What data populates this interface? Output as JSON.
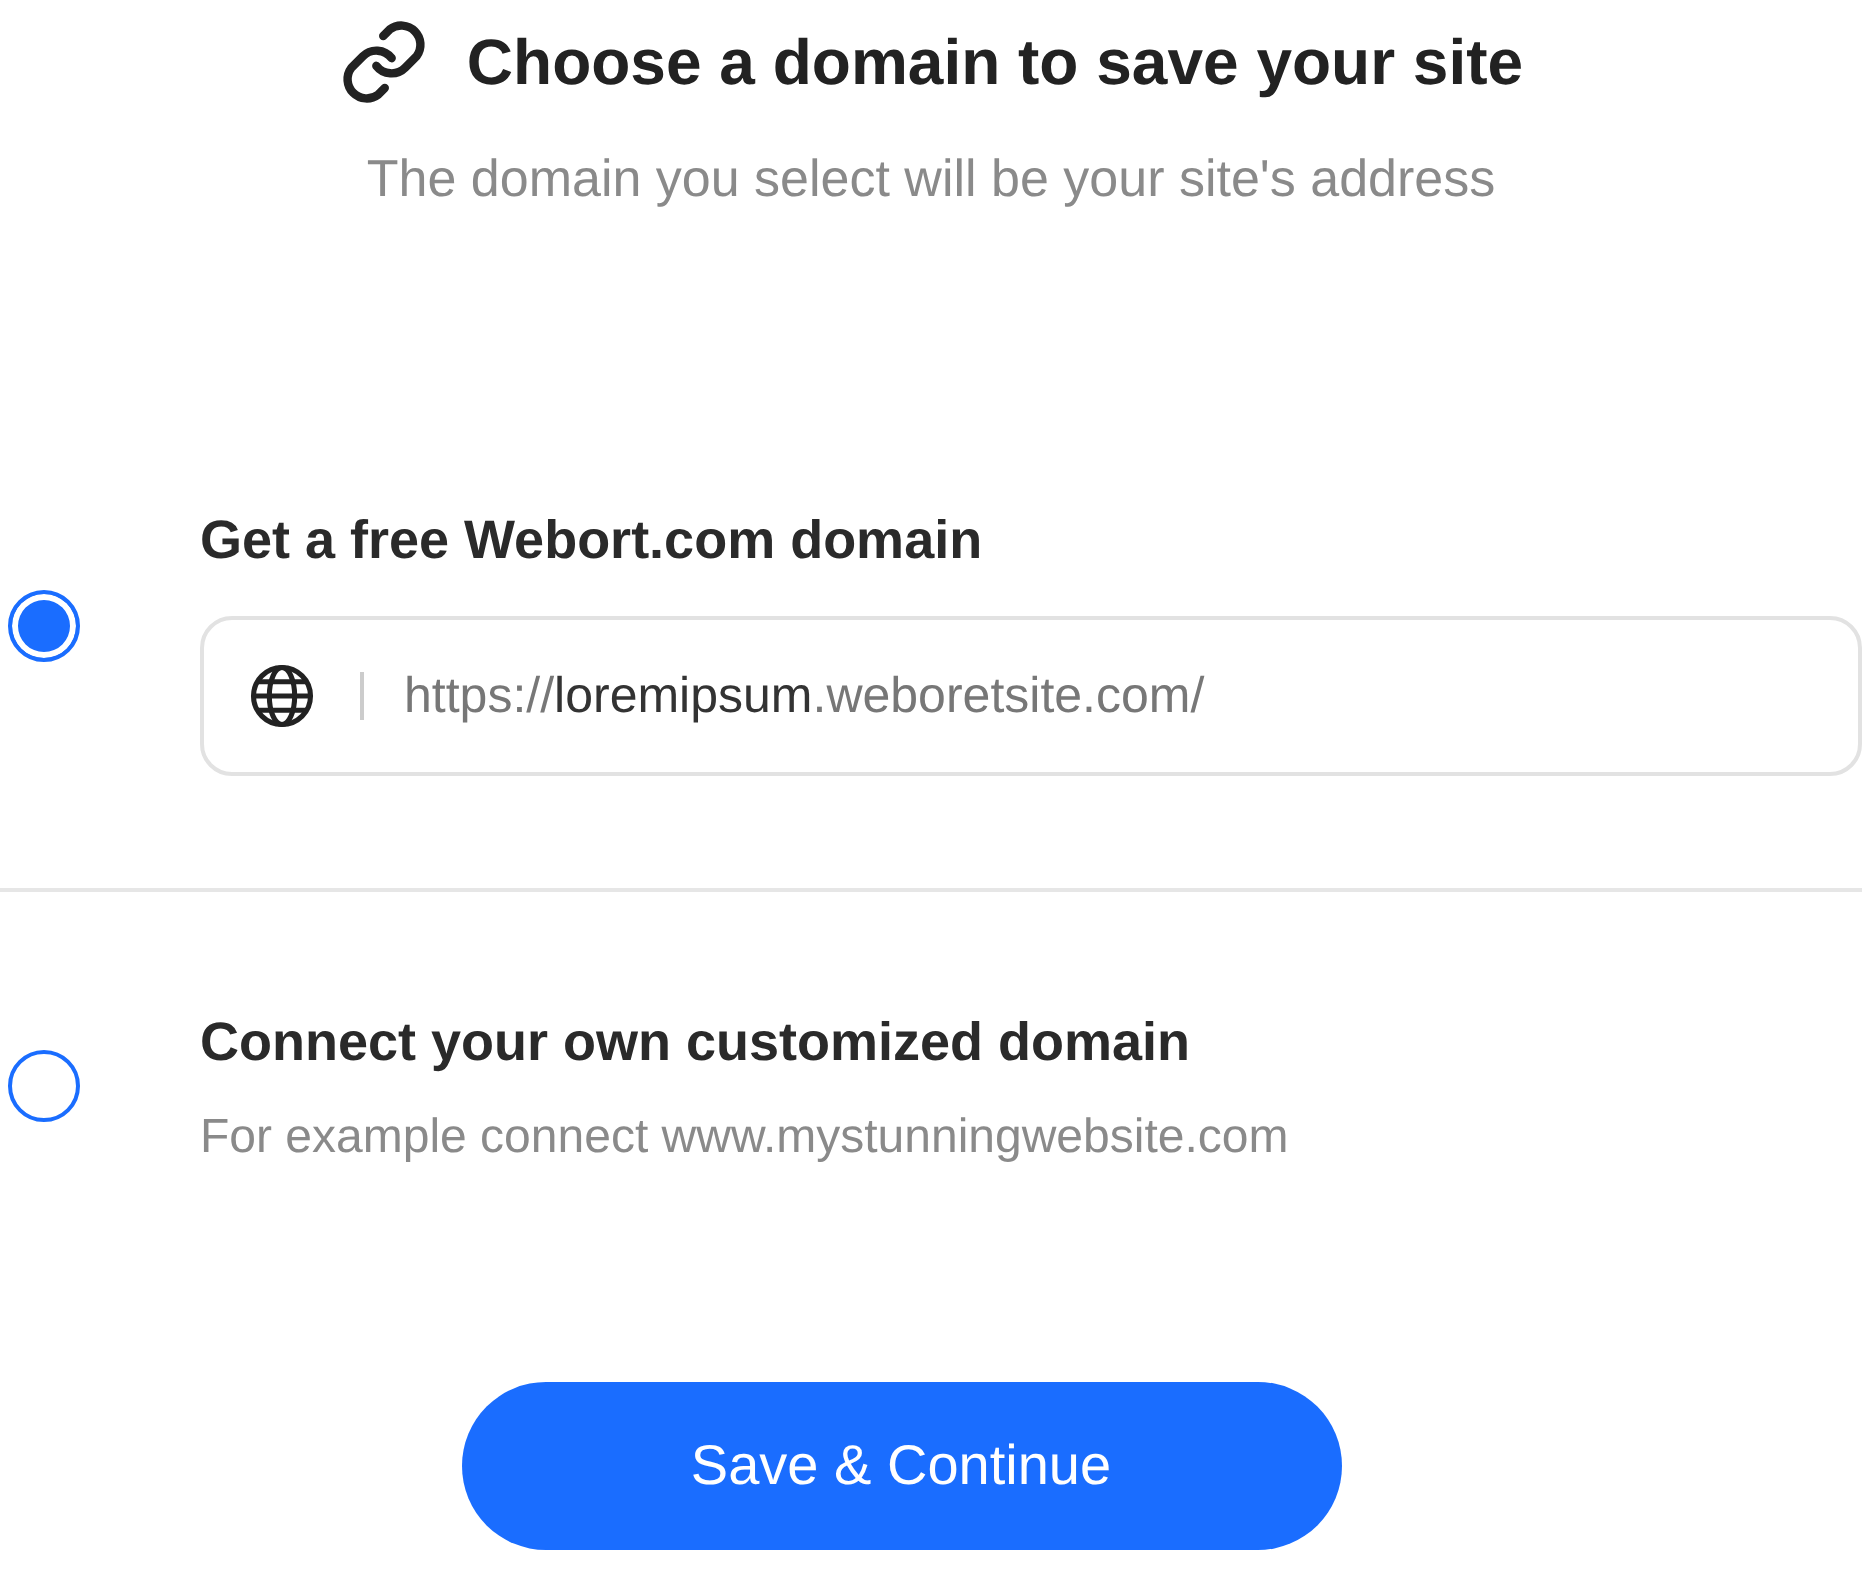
{
  "header": {
    "title": "Choose a domain to save your site",
    "subtitle": "The domain you select will be your site's address"
  },
  "options": [
    {
      "kind": "url_field",
      "selected": true,
      "label": "Get a free Webort.com domain",
      "value": "https://**loremipsum**.weboretsite.com/"
    },
    {
      "kind": "description",
      "selected": false,
      "label": "Connect your own customized domain",
      "description": "For example connect www.mystunningwebsite.com"
    }
  ],
  "button": "Save & Continue"
}
